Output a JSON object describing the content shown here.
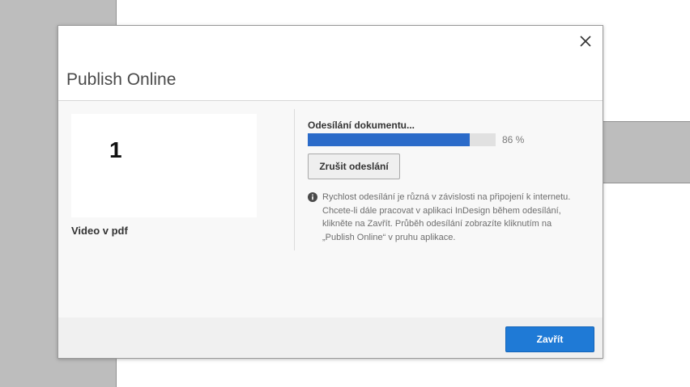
{
  "dialog": {
    "title": "Publish Online",
    "close_icon": "close-icon"
  },
  "document": {
    "page_number": "1",
    "name": "Video v pdf"
  },
  "upload": {
    "status_label": "Odesílání dokumentu...",
    "progress": 86,
    "progress_text": "86 %",
    "cancel_label": "Zrušit odeslání",
    "info_icon": "info-icon",
    "info_text": "Rychlost odesílání je různá v závislosti na připojení k internetu. Chcete-li dále pracovat v aplikaci InDesign během odesílání, klikněte na Zavřít. Průběh odesílání zobrazíte kliknutím na „Publish Online“ v pruhu aplikace."
  },
  "footer": {
    "close_label": "Zavřít"
  },
  "colors": {
    "accent": "#1f7ad6",
    "progress_fill": "#2b6bc9",
    "progress_track": "#e1e1e1"
  }
}
